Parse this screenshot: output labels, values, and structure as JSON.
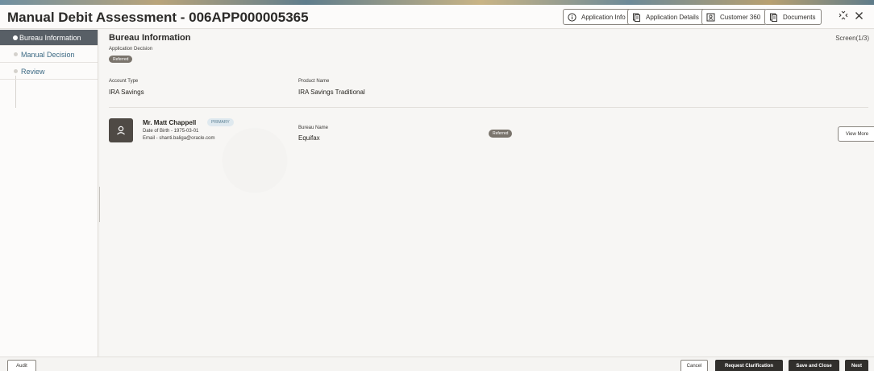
{
  "header": {
    "title": "Manual Debit Assessment - 006APP000005365",
    "buttons": {
      "application_info": "Application Info",
      "application_details": "Application Details",
      "customer_360": "Customer 360",
      "documents": "Documents"
    }
  },
  "sidebar": {
    "items": [
      {
        "label": "Bureau Information",
        "active": true
      },
      {
        "label": "Manual Decision",
        "active": false
      },
      {
        "label": "Review",
        "active": false
      }
    ]
  },
  "main": {
    "section_title": "Bureau Information",
    "screen_count": "Screen(1/3)",
    "application_decision_label": "Application Decision",
    "application_decision_value": "Referred",
    "account_type_label": "Account Type",
    "account_type_value": "IRA Savings",
    "product_name_label": "Product Name",
    "product_name_value": "IRA Savings Traditional",
    "applicant": {
      "name": "Mr. Matt Chappell",
      "badge": "PRIMARY",
      "dob": "Date of Birth - 1975-03-01",
      "email": "Email - shanti.baliga@oracle.com",
      "bureau_name_label": "Bureau Name",
      "bureau_name_value": "Equifax",
      "status": "Referred",
      "view_more": "View More"
    }
  },
  "footer": {
    "audit": "Audit",
    "cancel": "Cancel",
    "request_clarification": "Request Clarification",
    "save_and_close": "Save and Close",
    "next": "Next"
  }
}
